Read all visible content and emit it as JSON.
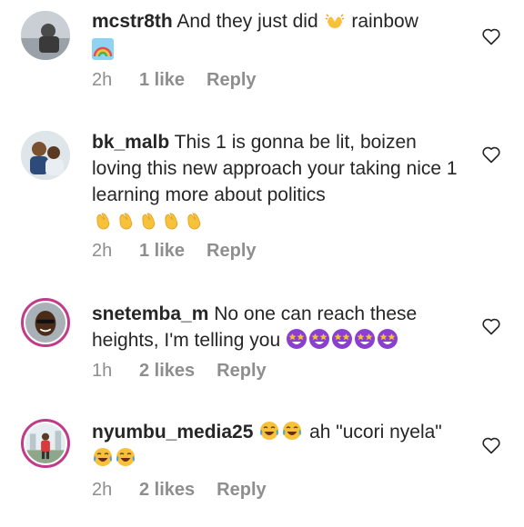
{
  "comments": [
    {
      "username": "mcstr8th",
      "text_before": "And they just did",
      "text_after": "rainbow",
      "emojis_inline": [
        "raising-hands"
      ],
      "emojis_line2": [
        "rainbow"
      ],
      "time": "2h",
      "likes": "1 like",
      "reply": "Reply"
    },
    {
      "username": "bk_malb",
      "text": "This 1 is gonna be lit, boizen loving this new approach your taking nice 1 learning more about politics",
      "emojis_line": [
        "clapping-hands",
        "clapping-hands",
        "clapping-hands",
        "clapping-hands",
        "clapping-hands"
      ],
      "time": "2h",
      "likes": "1 like",
      "reply": "Reply"
    },
    {
      "username": "snetemba_m",
      "text": "No one can reach these heights, I'm telling you",
      "emojis_inline": [
        "star-struck",
        "star-struck",
        "star-struck",
        "star-struck",
        "star-struck"
      ],
      "time": "1h",
      "likes": "2 likes",
      "reply": "Reply"
    },
    {
      "username": "nyumbu_media25",
      "text_mid": "ah \"ucori nyela\"",
      "emojis_before": [
        "tears-of-joy",
        "tears-of-joy"
      ],
      "emojis_after": [
        "tears-of-joy",
        "tears-of-joy"
      ],
      "time": "2h",
      "likes": "2 likes",
      "reply": "Reply"
    }
  ],
  "colors": {
    "text": "#262626",
    "meta": "#8e8e8e",
    "story_ring": "#c23a8a"
  }
}
